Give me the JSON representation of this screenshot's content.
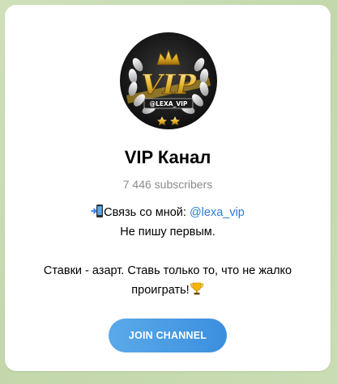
{
  "channel": {
    "name": "VIP Канал",
    "subscribers": "7 446 subscribers",
    "avatar": {
      "text_main": "VIP",
      "text_handle": "@LEXA_VIP",
      "icon": "vip-crown-badge"
    },
    "description": {
      "contact_prefix": "Связь со мной: ",
      "contact_link": "@lexa_vip",
      "contact_icon": "phone-arrow-icon",
      "line2": "Не пишу первым.",
      "line4": "Ставки - азарт. Ставь только то, что не жалко",
      "line5": "проиграть!",
      "line5_icon": "trophy-icon"
    },
    "join_button": "JOIN CHANNEL"
  },
  "colors": {
    "link": "#2a7bd6",
    "button_start": "#5aa9ea",
    "button_end": "#3b8fdd",
    "background": "#c9dbb4",
    "subtitle": "#8a8a8a"
  }
}
